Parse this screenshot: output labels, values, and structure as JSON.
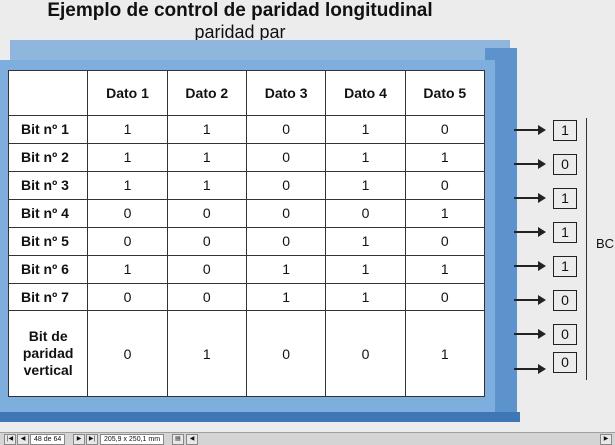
{
  "title": "Ejemplo de control de paridad longitudinal",
  "subtitle": "paridad par",
  "table": {
    "headers": [
      "Dato 1",
      "Dato 2",
      "Dato 3",
      "Dato 4",
      "Dato 5"
    ],
    "rows": [
      {
        "label": "Bit nº 1",
        "values": [
          "1",
          "1",
          "0",
          "1",
          "0"
        ]
      },
      {
        "label": "Bit nº 2",
        "values": [
          "1",
          "1",
          "0",
          "1",
          "1"
        ]
      },
      {
        "label": "Bit nº 3",
        "values": [
          "1",
          "1",
          "0",
          "1",
          "0"
        ]
      },
      {
        "label": "Bit nº 4",
        "values": [
          "0",
          "0",
          "0",
          "0",
          "1"
        ]
      },
      {
        "label": "Bit nº 5",
        "values": [
          "0",
          "0",
          "0",
          "1",
          "0"
        ]
      },
      {
        "label": "Bit nº 6",
        "values": [
          "1",
          "0",
          "1",
          "1",
          "1"
        ]
      },
      {
        "label": "Bit nº 7",
        "values": [
          "0",
          "0",
          "1",
          "1",
          "0"
        ]
      }
    ],
    "parity_row": {
      "label_line1": "Bit de paridad",
      "label_line2": "vertical",
      "values": [
        "0",
        "1",
        "0",
        "0",
        "1"
      ]
    }
  },
  "parity_column": [
    "1",
    "0",
    "1",
    "1",
    "1",
    "0",
    "0",
    "0"
  ],
  "bracket_label": "BC",
  "status_bar": {
    "page": "48 de 64",
    "size": "205,9 x 250,1 mm"
  },
  "colors": {
    "panel_front": "#7eaedd",
    "panel_side": "#5d93cc",
    "panel_bottom": "#3f77b6"
  }
}
